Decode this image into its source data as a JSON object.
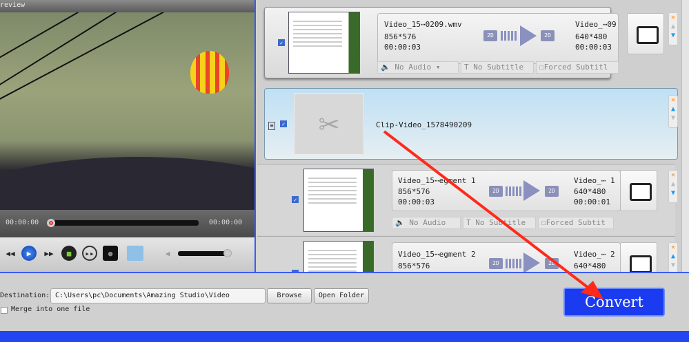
{
  "preview": {
    "title": "Preview",
    "time_current": "00:00:00",
    "time_total": "00:00:00",
    "seek_progress": 0,
    "volume": 1.0
  },
  "controls": [
    "rewind",
    "play",
    "fast-forward",
    "stop",
    "next-frame",
    "snapshot",
    "open-folder"
  ],
  "items": [
    {
      "source_name": "Video_15⋯0209.wmv",
      "source_res": "856*576",
      "source_dur": "00:00:03",
      "from_mode": "2D",
      "to_mode": "2D",
      "output_name": "Video_⋯09",
      "output_res": "640*480",
      "output_dur": "00:00:03",
      "audio": "No Audio",
      "subtitle": "No Subtitle",
      "forced_subtitle": "Forced Subtitl",
      "checked": true
    },
    {
      "clip_name": "Clip-Video_1578490209",
      "checked": true
    },
    {
      "source_name": "Video_15⋯egment 1",
      "source_res": "856*576",
      "source_dur": "00:00:03",
      "from_mode": "2D",
      "to_mode": "2D",
      "output_name": "Video_⋯ 1",
      "output_res": "640*480",
      "output_dur": "00:00:01",
      "audio": "No Audio",
      "subtitle": "No Subtitle",
      "forced_subtitle": "Forced Subtit",
      "checked": true
    },
    {
      "source_name": "Video_15⋯egment 2",
      "source_res": "856*576",
      "from_mode": "2D",
      "to_mode": "2D",
      "output_name": "Video_⋯ 2",
      "output_res": "640*480",
      "checked": true
    }
  ],
  "bottom": {
    "destination_label": "Destination:",
    "destination_value": "C:\\Users\\pc\\Documents\\Amazing Studio\\Video",
    "browse": "Browse",
    "open_folder": "Open Folder",
    "merge_label": "Merge into one file",
    "merge_checked": false,
    "convert": "Convert"
  },
  "colors": {
    "accent": "#2446f0",
    "annotation_arrow": "#ff2a1a"
  }
}
